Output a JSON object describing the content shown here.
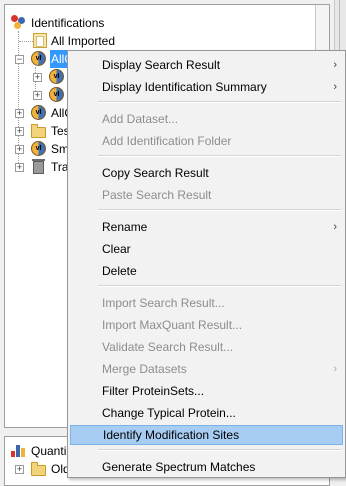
{
  "tree": {
    "root_label": "Identifications",
    "all_imported_label": "All Imported",
    "node_allc_label": "AllC",
    "node_allo_label": "AllO",
    "node_tes_label": "Tes",
    "node_sma_label": "Sma",
    "node_tra_label": "Tra",
    "ident_badge": "vI"
  },
  "bottom_tree": {
    "root_label": "Quanti",
    "old_label": "Old"
  },
  "menu": {
    "items": [
      {
        "label": "Display Search Result",
        "enabled": true,
        "submenu": true
      },
      {
        "label": "Display Identification Summary",
        "enabled": true,
        "submenu": true
      },
      {
        "label": "Add Dataset...",
        "enabled": false,
        "submenu": false
      },
      {
        "label": "Add Identification Folder",
        "enabled": false,
        "submenu": false
      },
      {
        "label": "Copy Search Result",
        "enabled": true,
        "submenu": false
      },
      {
        "label": "Paste Search Result",
        "enabled": false,
        "submenu": false
      },
      {
        "label": "Rename",
        "enabled": true,
        "submenu": true
      },
      {
        "label": "Clear",
        "enabled": true,
        "submenu": false
      },
      {
        "label": "Delete",
        "enabled": true,
        "submenu": false
      },
      {
        "label": "Import Search Result...",
        "enabled": false,
        "submenu": false
      },
      {
        "label": "Import MaxQuant Result...",
        "enabled": false,
        "submenu": false
      },
      {
        "label": "Validate Search Result...",
        "enabled": false,
        "submenu": false
      },
      {
        "label": "Merge Datasets",
        "enabled": false,
        "submenu": true
      },
      {
        "label": "Filter ProteinSets...",
        "enabled": true,
        "submenu": false
      },
      {
        "label": "Change Typical Protein...",
        "enabled": true,
        "submenu": false
      },
      {
        "label": "Identify Modification Sites",
        "enabled": true,
        "submenu": false,
        "highlighted": true
      },
      {
        "label": "Generate Spectrum Matches",
        "enabled": true,
        "submenu": false
      }
    ],
    "submenu_arrow": "›"
  }
}
